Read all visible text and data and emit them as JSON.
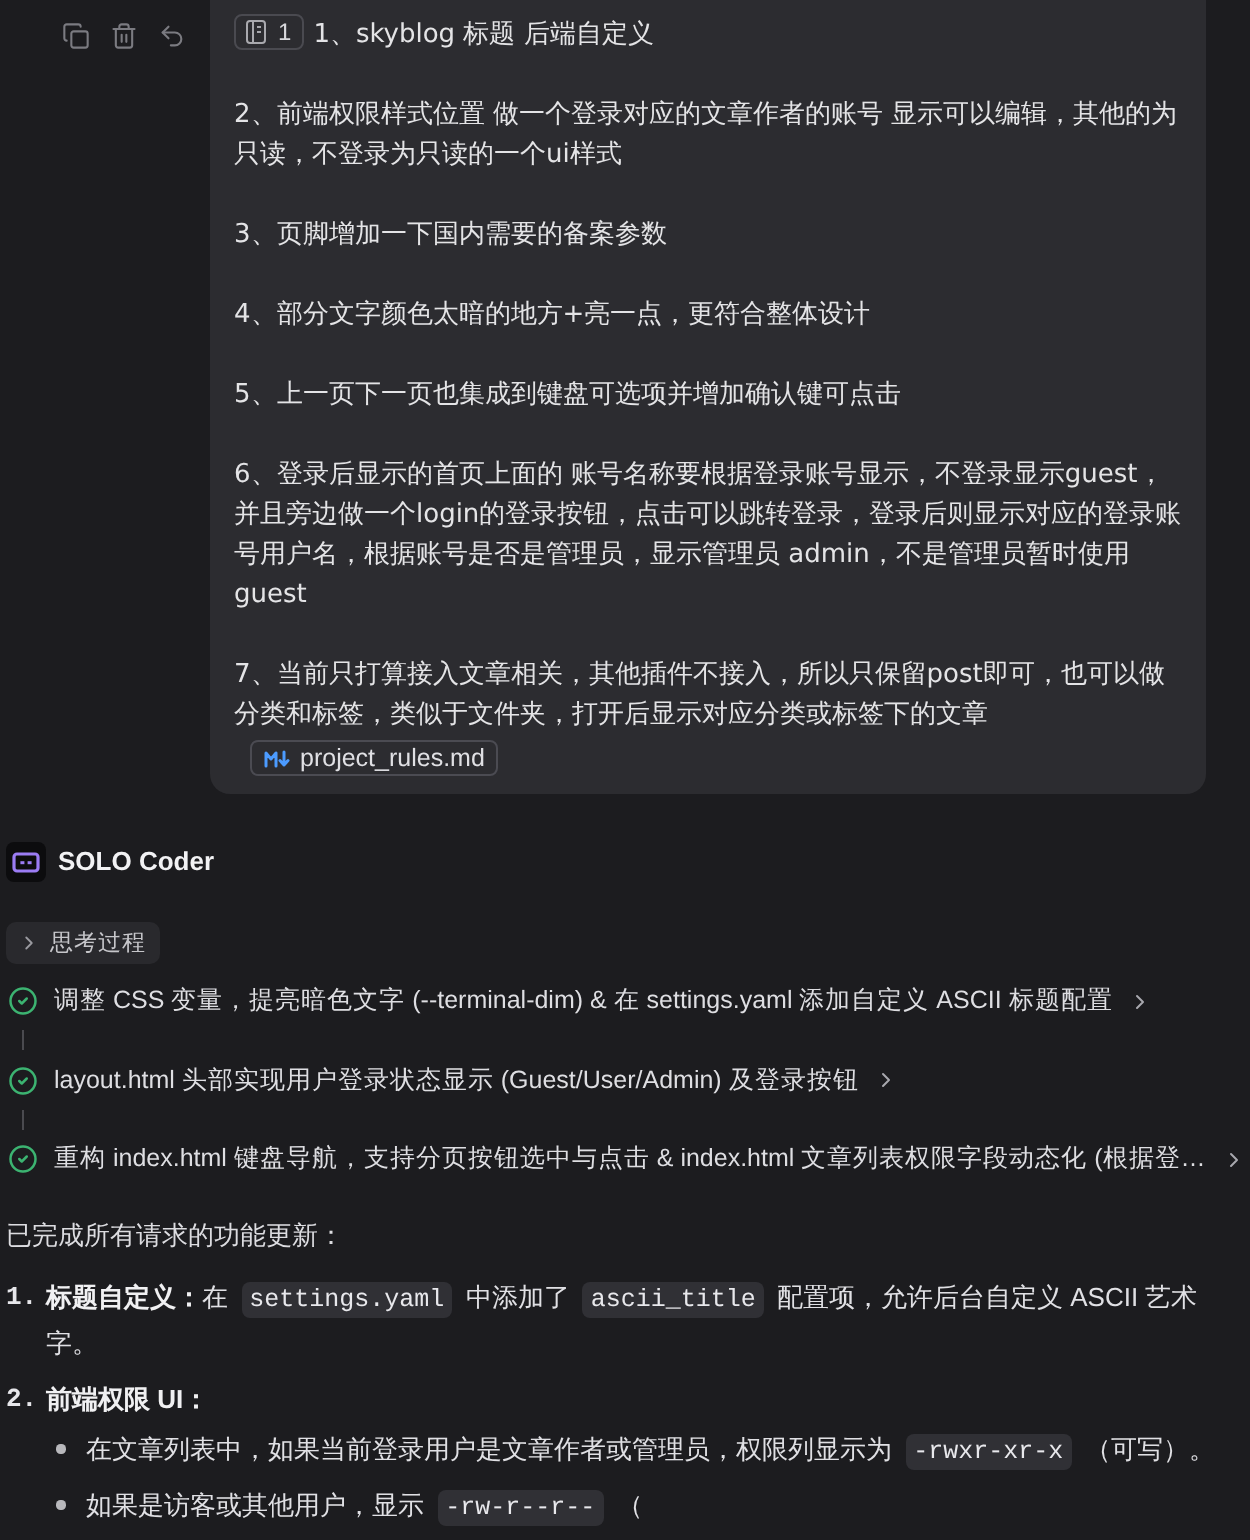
{
  "user_message": {
    "reference": {
      "label": "1"
    },
    "paragraphs": [
      "1、skyblog 标题 后端自定义",
      "2、前端权限样式位置 做一个登录对应的文章作者的账号 显示可以编辑，其他的为只读，不登录为只读的一个ui样式",
      "3、页脚增加一下国内需要的备案参数",
      "4、部分文字颜色太暗的地方+亮一点，更符合整体设计",
      "5、上一页下一页也集成到键盘可选项并增加确认键可点击",
      "6、登录后显示的首页上面的 账号名称要根据登录账号显示，不登录显示guest，并且旁边做一个login的登录按钮，点击可以跳转登录，登录后则显示对应的登录账号用户名，根据账号是否是管理员，显示管理员 admin，不是管理员暂时使用guest",
      "7、当前只打算接入文章相关，其他插件不接入，所以只保留post即可，也可以做分类和标签，类似于文件夹，打开后显示对应分类或标签下的文章"
    ],
    "attachment": {
      "name": "project_rules.md"
    }
  },
  "assistant": {
    "name": "SOLO Coder",
    "thinking": {
      "label": "思考过程",
      "expanded": false
    },
    "steps": [
      {
        "text": "调整 CSS 变量，提亮暗色文字 (--terminal-dim) & 在 settings.yaml 添加自定义 ASCII 标题配置",
        "done": true
      },
      {
        "text": "layout.html 头部实现用户登录状态显示 (Guest/User/Admin) 及登录按钮",
        "done": true
      },
      {
        "text": "重构 index.html 键盘导航，支持分页按钮选中与点击 & index.html 文章列表权限字段动态化 (根据登…",
        "done": true
      }
    ],
    "summary": "已完成所有请求的功能更新：",
    "items": [
      {
        "number": "1.",
        "parts": [
          {
            "kind": "bold",
            "text": "标题自定义："
          },
          {
            "kind": "text",
            "text": "在 "
          },
          {
            "kind": "code",
            "text": "settings.yaml"
          },
          {
            "kind": "text",
            "text": " 中添加了 "
          },
          {
            "kind": "code",
            "text": "ascii_title"
          },
          {
            "kind": "text",
            "text": " 配置项，允许后台自定义 ASCII 艺术字。"
          }
        ]
      },
      {
        "number": "2.",
        "parts": [
          {
            "kind": "bold",
            "text": "前端权限 UI："
          }
        ],
        "children": [
          {
            "parts": [
              {
                "kind": "text",
                "text": "在文章列表中，如果当前登录用户是文章作者或管理员，权限列显示为 "
              },
              {
                "kind": "code",
                "text": "-rwxr-xr-x"
              },
              {
                "kind": "text",
                "text": " （可写）。"
              }
            ]
          },
          {
            "parts": [
              {
                "kind": "text",
                "text": "如果是访客或其他用户，显示 "
              },
              {
                "kind": "code",
                "text": "-rw-r--r--"
              },
              {
                "kind": "text",
                "text": " （"
              }
            ]
          }
        ]
      }
    ]
  }
}
